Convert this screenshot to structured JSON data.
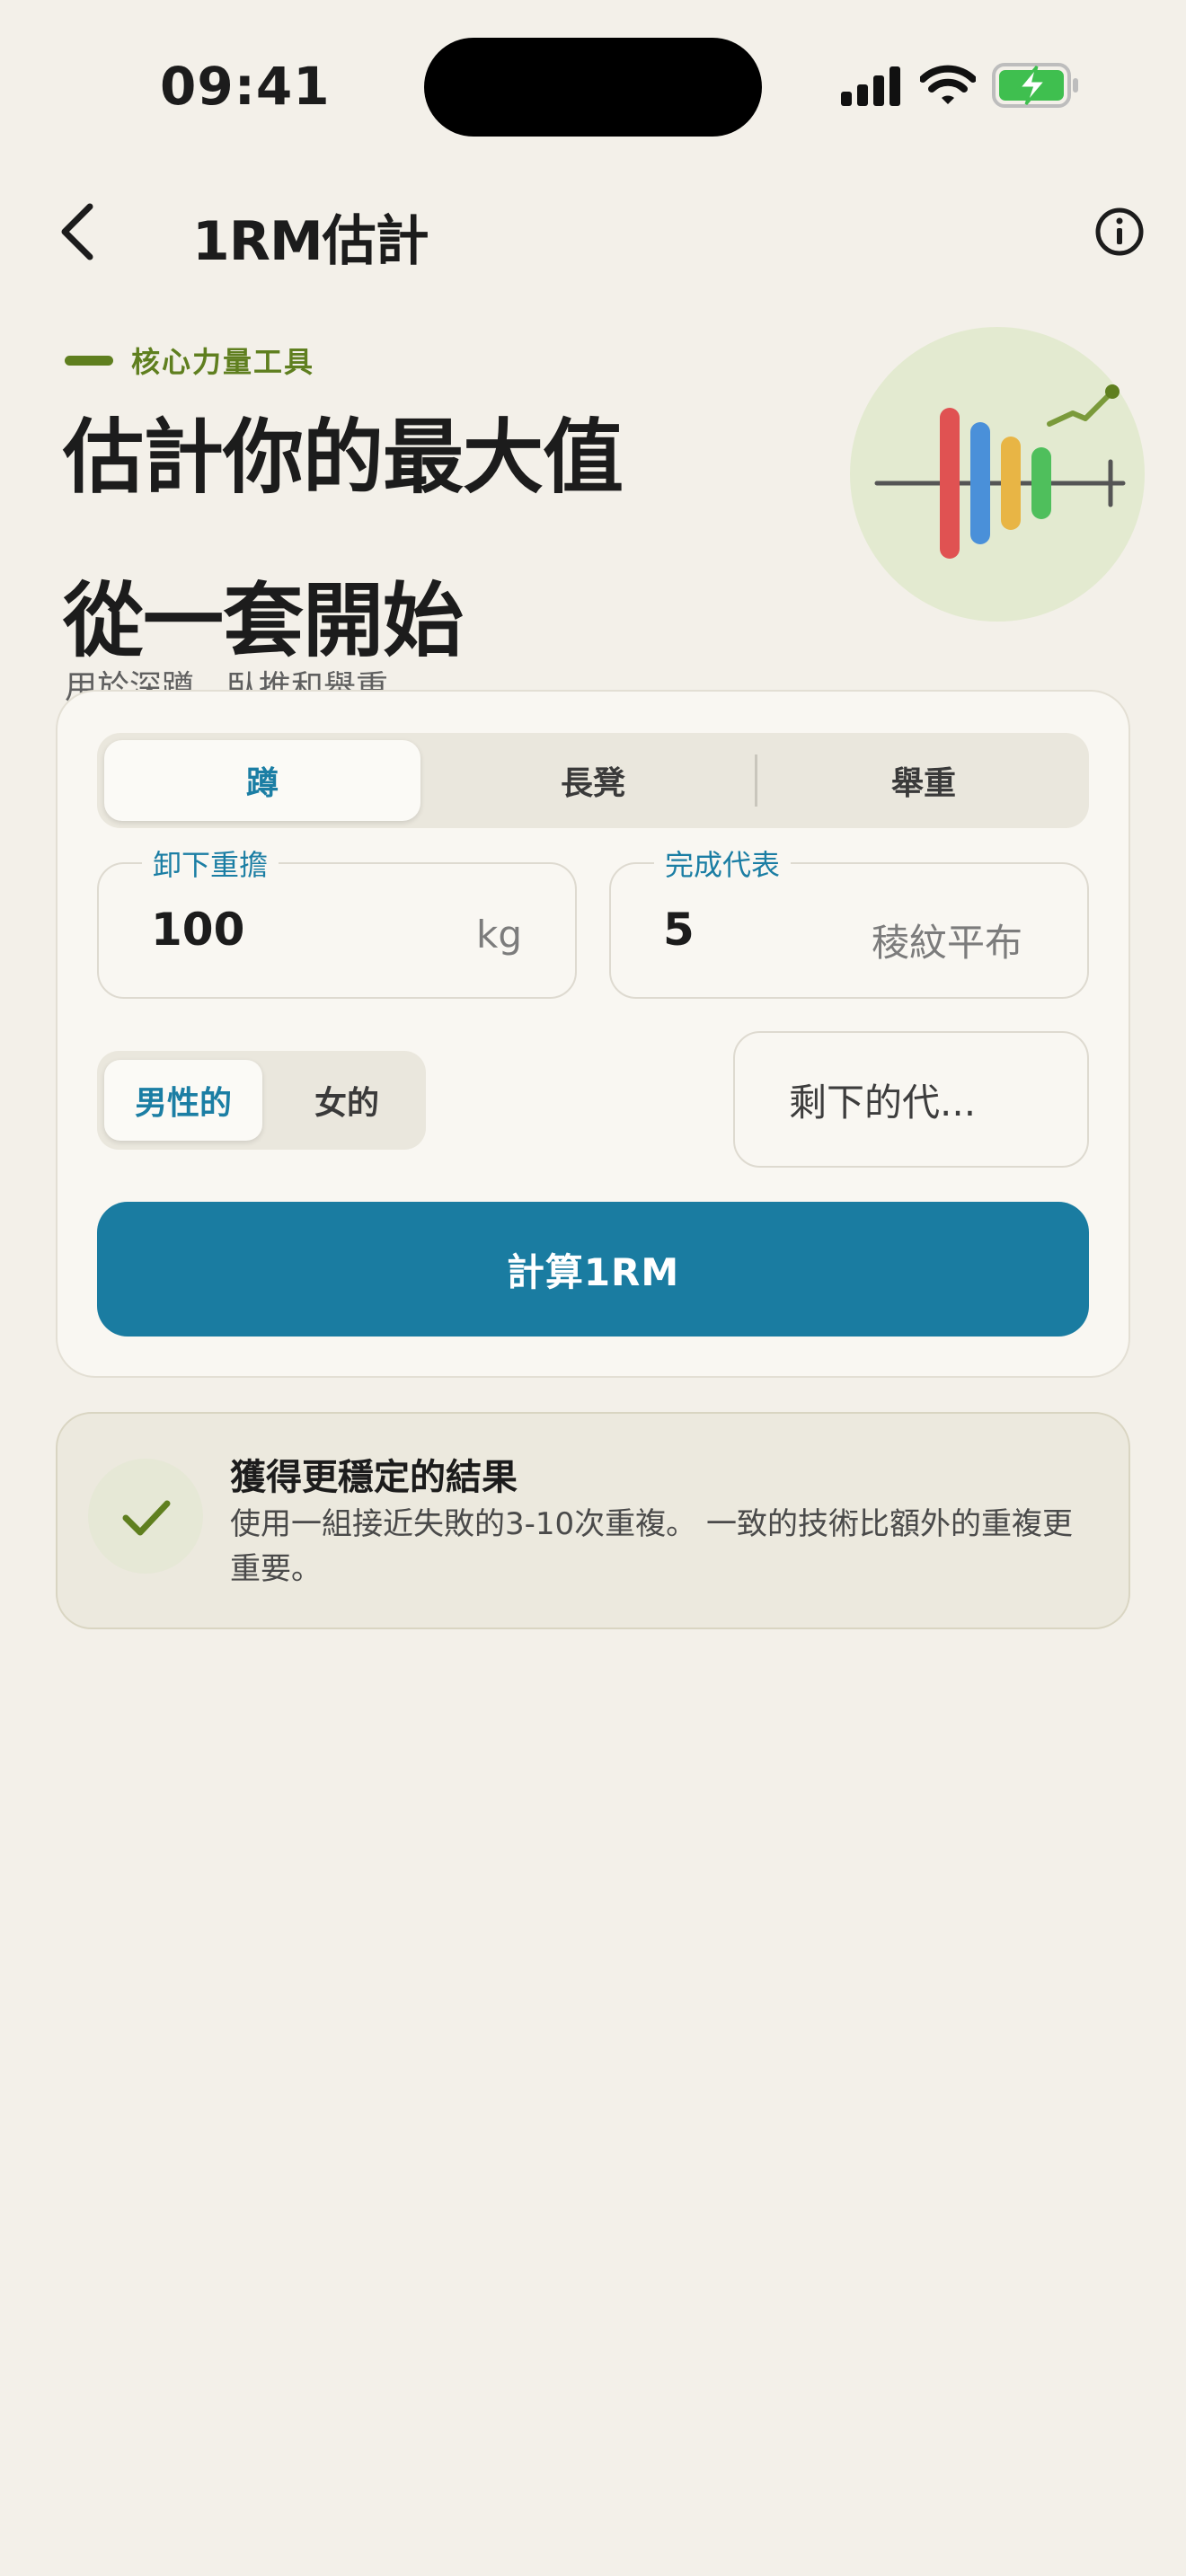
{
  "status_bar": {
    "time": "09:41",
    "icons": [
      "signal-icon",
      "wifi-icon",
      "battery-charging-icon"
    ]
  },
  "header": {
    "title": "1RM估計",
    "back_icon": "chevron-left-icon",
    "info_icon": "info-icon"
  },
  "hero": {
    "eyebrow": "核心力量工具",
    "title_line1": "估計你的最大值",
    "title_line2": "從一套開始",
    "subtitle": "用於深蹲、臥推和舉重",
    "illustration_icon": "barbell-chart-icon"
  },
  "lift_tabs": {
    "items": [
      "蹲",
      "長凳",
      "舉重"
    ],
    "selected": "蹲"
  },
  "weight_field": {
    "label": "卸下重擔",
    "value": "100",
    "unit": "kg"
  },
  "reps_field": {
    "label": "完成代表",
    "value": "5",
    "suffix": "稜紋平布"
  },
  "sex_toggle": {
    "items": [
      "男性的",
      "女的"
    ],
    "selected": "男性的"
  },
  "rir_select": {
    "value": "剩下的代..."
  },
  "calculate_button": {
    "label": "計算1RM"
  },
  "tip": {
    "icon": "check-icon",
    "title": "獲得更穩定的結果",
    "body": "使用一組接近失敗的3-10次重複。 一致的技術比額外的重複更重要。"
  },
  "colors": {
    "background": "#f3f0e9",
    "accent_blue": "#1a7ca1",
    "accent_green": "#5f7f1f",
    "battery_green": "#3fbf4f"
  }
}
